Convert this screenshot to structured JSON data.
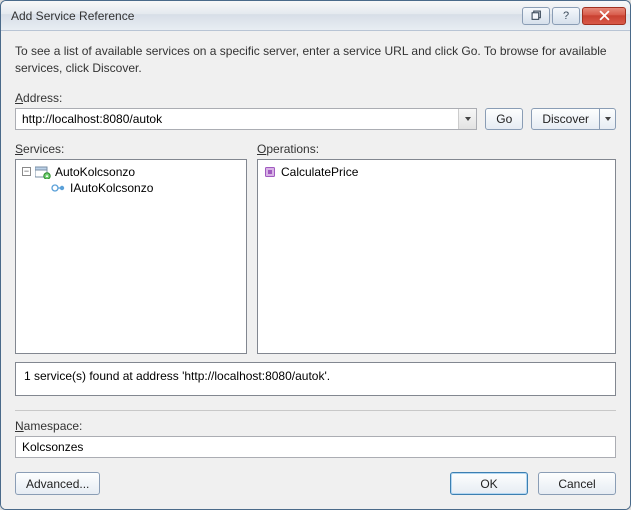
{
  "window": {
    "title": "Add Service Reference"
  },
  "intro": "To see a list of available services on a specific server, enter a service URL and click Go. To browse for available services, click Discover.",
  "address": {
    "label": "Address:",
    "value": "http://localhost:8080/autok"
  },
  "buttons": {
    "go": "Go",
    "discover": "Discover",
    "advanced": "Advanced...",
    "ok": "OK",
    "cancel": "Cancel"
  },
  "services": {
    "label": "Services:",
    "root": "AutoKolcsonzo",
    "child": "IAutoKolcsonzo"
  },
  "operations": {
    "label": "Operations:",
    "items": [
      "CalculatePrice"
    ]
  },
  "status": "1 service(s) found at address 'http://localhost:8080/autok'.",
  "namespace": {
    "label": "Namespace:",
    "value": "Kolcsonzes"
  }
}
